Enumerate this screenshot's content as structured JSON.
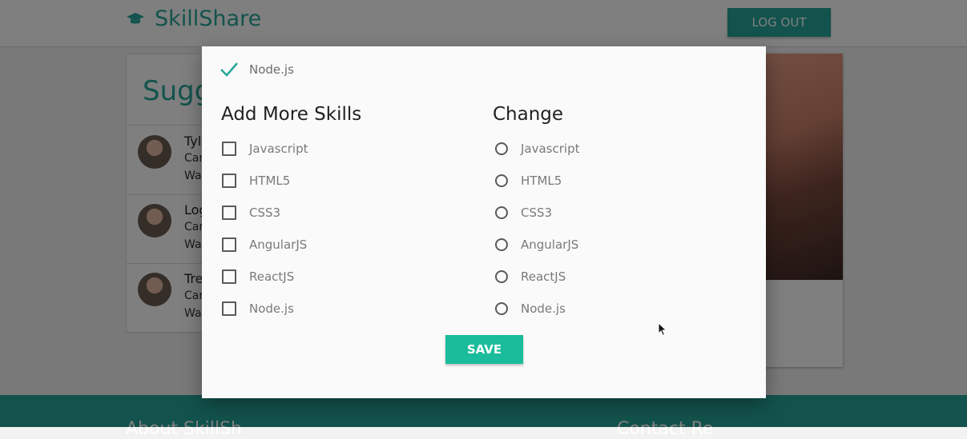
{
  "app": {
    "brand": "SkillShare",
    "logout_label": "LOG OUT"
  },
  "suggestions": {
    "title": "Sugg",
    "people": [
      {
        "name": "Tyl",
        "line1": "Car",
        "line2": "Wa"
      },
      {
        "name": "Log",
        "line1": "Car",
        "line2": "Wa"
      },
      {
        "name": "Tre",
        "line1": "Car",
        "line2": "Wa"
      }
    ]
  },
  "footer": {
    "about": "About SkillSh",
    "contact": "Contact Re"
  },
  "modal": {
    "current_skill": "Node.js",
    "add_title": "Add More Skills",
    "change_title": "Change",
    "add_skills": [
      "Javascript",
      "HTML5",
      "CSS3",
      "AngularJS",
      "ReactJS",
      "Node.js"
    ],
    "change_skills": [
      "Javascript",
      "HTML5",
      "CSS3",
      "AngularJS",
      "ReactJS",
      "Node.js"
    ],
    "save_label": "SAVE"
  },
  "colors": {
    "accent": "#26a69a",
    "save": "#1abc9c"
  },
  "icons": {
    "brand": "graduation-cap-icon",
    "check": "checkmark-icon",
    "cursor": "mouse-pointer-icon"
  }
}
